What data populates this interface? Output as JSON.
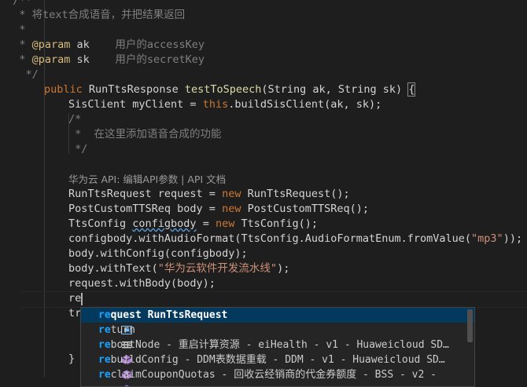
{
  "editor": {
    "lines": {
      "l0": "  /**",
      "l1": "   * 将text合成语音，并把结果返回",
      "l2": "   *",
      "l3a": "   * ",
      "l3b": "@param",
      "l3c": " ak    ",
      "l3d": "用户的accessKey",
      "l4a": "   * ",
      "l4b": "@param",
      "l4c": " sk    ",
      "l4d": "用户的secretKey",
      "l5": "    */",
      "l6a": "public",
      "l6b": " RunTtsResponse ",
      "l6c": "testToSpeech",
      "l6d": "(String ak, String sk) ",
      "l6e": "{",
      "l7a": "SisClient myClient = ",
      "l7b": "this",
      "l7c": ".buildSisClient(ak, sk);",
      "l8": "/*",
      "l9": " *  在这里添加语音合成的功能",
      "l10": " */",
      "l12a": "RunTtsRequest request = ",
      "l12b": "new",
      "l12c": " RunTtsRequest();",
      "l13a": "PostCustomTTSReq body = ",
      "l13b": "new",
      "l13c": " PostCustomTTSReq();",
      "l14a": "TtsConfig ",
      "l14b": "configbody",
      "l14c": " = ",
      "l14d": "new",
      "l14e": " TtsConfig();",
      "l15a": "configbody.withAudioFormat(TtsConfig.AudioFormatEnum.fromValue(",
      "l15b": "\"mp3\"",
      "l15c": "));",
      "l16": "body.withConfig(configbody);",
      "l17a": "body.withText(",
      "l17b": "\"华为云软件开发流水线\"",
      "l17c": ");",
      "l18": "request.withBody(body);",
      "l19": "re",
      "l20": "tr",
      "l22": "}"
    },
    "hint_text": "华为云 API: 编辑API参数 | API 文档"
  },
  "suggestions": {
    "items": [
      {
        "match": "re",
        "rest": "quest",
        "detail": " RunTtsRequest",
        "icon": "variable-icon"
      },
      {
        "match": "re",
        "rest": "turn",
        "detail": "",
        "icon": "keyword-snippet-icon"
      },
      {
        "match": "re",
        "rest": "bootNode",
        "detail": " - 重启计算资源 - eiHealth - v1 - Huaweicloud SD…",
        "icon": "cube-icon"
      },
      {
        "match": "re",
        "rest": "buildConfig",
        "detail": " - DDM表数据重载 - DDM - v1 - Huaweicloud SD…",
        "icon": "cube-icon"
      },
      {
        "match": "re",
        "rest": "claimCouponQuotas",
        "detail": " - 回收云经销商的代金券额度 - BSS - v2 -",
        "icon": "cube-icon"
      }
    ]
  },
  "colors": {
    "accent": "#18a3ff",
    "selection": "#04395e",
    "keyword": "#cc7832",
    "string": "#ce9178"
  }
}
